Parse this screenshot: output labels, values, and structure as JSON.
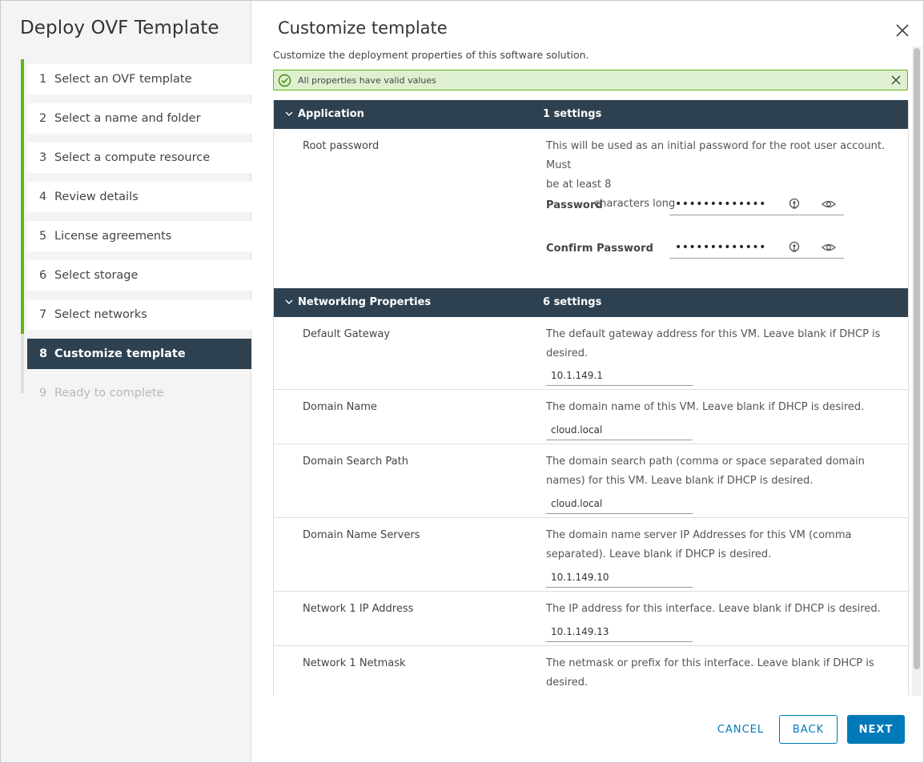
{
  "wizard": {
    "title": "Deploy OVF Template",
    "steps": [
      {
        "num": "1",
        "label": "Select an OVF template"
      },
      {
        "num": "2",
        "label": "Select a name and folder"
      },
      {
        "num": "3",
        "label": "Select a compute resource"
      },
      {
        "num": "4",
        "label": "Review details"
      },
      {
        "num": "5",
        "label": "License agreements"
      },
      {
        "num": "6",
        "label": "Select storage"
      },
      {
        "num": "7",
        "label": "Select networks"
      },
      {
        "num": "8",
        "label": "Customize template"
      },
      {
        "num": "9",
        "label": "Ready to complete"
      }
    ],
    "active_step": "8"
  },
  "main": {
    "title": "Customize template",
    "subtitle": "Customize the deployment properties of this software solution.",
    "alert": "All properties have valid values"
  },
  "groups": {
    "application": {
      "name": "Application",
      "count": "1 settings",
      "root_password": {
        "name": "Root password",
        "desc_line1": "This will be used as an initial password for the root user account. Must",
        "desc_line2": "be at least 8",
        "desc_line3": "characters long",
        "password_label": "Password",
        "password_value": "•••••••••••••",
        "confirm_label": "Confirm Password",
        "confirm_value": "•••••••••••••"
      }
    },
    "networking": {
      "name": "Networking Properties",
      "count": "6 settings",
      "props": [
        {
          "name": "Default Gateway",
          "desc": "The default gateway address for this VM. Leave blank if DHCP is desired.",
          "value": "10.1.149.1"
        },
        {
          "name": "Domain Name",
          "desc": "The domain name of this VM. Leave blank if DHCP is desired.",
          "value": "cloud.local"
        },
        {
          "name": "Domain Search Path",
          "desc": "The domain search path (comma or space separated domain names) for this VM. Leave blank if DHCP is desired.",
          "value": "cloud.local"
        },
        {
          "name": "Domain Name Servers",
          "desc": "The domain name server IP Addresses for this VM (comma separated). Leave blank if DHCP is desired.",
          "value": "10.1.149.10"
        },
        {
          "name": "Network 1 IP Address",
          "desc": "The IP address for this interface. Leave blank if DHCP is desired.",
          "value": "10.1.149.13"
        },
        {
          "name": "Network 1 Netmask",
          "desc": "The netmask or prefix for this interface. Leave blank if DHCP is desired.",
          "value": ""
        }
      ]
    }
  },
  "footer": {
    "cancel": "CANCEL",
    "back": "BACK",
    "next": "NEXT"
  },
  "colors": {
    "accent": "#0079b8",
    "header_dark": "#2e4150",
    "success": "#60b515"
  },
  "icons": [
    "close-icon",
    "check-circle-icon",
    "chevron-down-icon",
    "key-generate-icon",
    "eye-icon"
  ]
}
